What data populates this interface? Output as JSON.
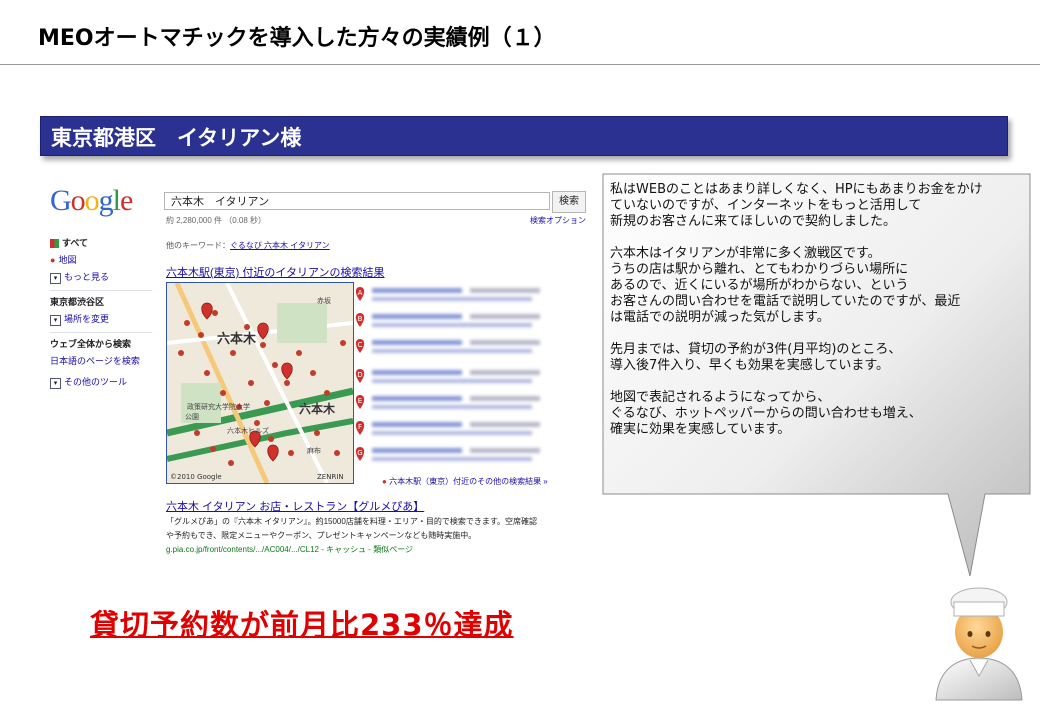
{
  "slide": {
    "title": "MEOオートマチックを導入した方々の実績例（１）",
    "banner": "東京都港区　イタリアン様",
    "result": "貸切予約数が前月比233％達成"
  },
  "google": {
    "logo": "Google",
    "query": "六本木　イタリアン",
    "search_button": "検索",
    "result_count": "約 2,280,000 件 （0.08 秒）",
    "search_options": "検索オプション",
    "sidebar": {
      "all": "すべて",
      "maps": "地図",
      "more": "もっと見る",
      "location_heading": "東京都渋谷区",
      "change_location": "場所を変更",
      "web_heading": "ウェブ全体から検索",
      "japanese_pages": "日本語のページを検索",
      "other_tools": "その他のツール"
    },
    "other_keywords_label": "他のキーワード：",
    "other_keywords_link": "ぐるなび 六本木 イタリアン",
    "local_heading": "六本木駅(東京) 付近のイタリアンの検索結果",
    "map_labels": [
      "六本木",
      "六本木",
      "赤坂",
      "政策研究大学院大学",
      "公園",
      "六本木ヒルズ",
      "麻布"
    ],
    "map_copyright": "©2010 Google",
    "map_credit": "ZENRIN",
    "pin_letters": [
      "A",
      "B",
      "C",
      "D",
      "E",
      "F",
      "G"
    ],
    "more_results": "六本木駅（東京）付近のその他の検索結果 »",
    "result": {
      "title": "六本木 イタリアン お店・レストラン【グルメぴあ】",
      "snippet1": "「グルメぴあ」の『六本木 イタリアン』。約15000店舗を料理・エリア・目的で検索できます。空席確認",
      "snippet2": "や予約もでき、限定メニューやクーポン、プレゼントキャンペーンなども随時実施中。",
      "url": "g.pia.co.jp/front/contents/.../AC004/.../CL12 - キャッシュ - 類似ページ"
    }
  },
  "testimonial": {
    "p1": "私はWEBのことはあまり詳しくなく、HPにもあまりお金をかけ\nていないのですが、インターネットをもっと活用して\n新規のお客さんに来てほしいので契約しました。",
    "p2": "六本木はイタリアンが非常に多く激戦区です。\nうちの店は駅から離れ、とてもわかりづらい場所に\nあるので、近くにいるが場所がわからない、という\nお客さんの問い合わせを電話で説明していたのですが、最近\nは電話での説明が減った気がします。",
    "p3": "先月までは、貸切の予約が3件(月平均)のところ、\n導入後7件入り、早くも効果を実感しています。",
    "p4": "地図で表記されるようになってから、\nぐるなび、ホットペッパーからの問い合わせも増え、\n確実に効果を実感しています。"
  },
  "colors": {
    "banner": "#2b3190",
    "result_text": "#e00000",
    "link": "#1a0dab"
  },
  "icons": [
    "chef-icon",
    "map-pin-icon"
  ]
}
